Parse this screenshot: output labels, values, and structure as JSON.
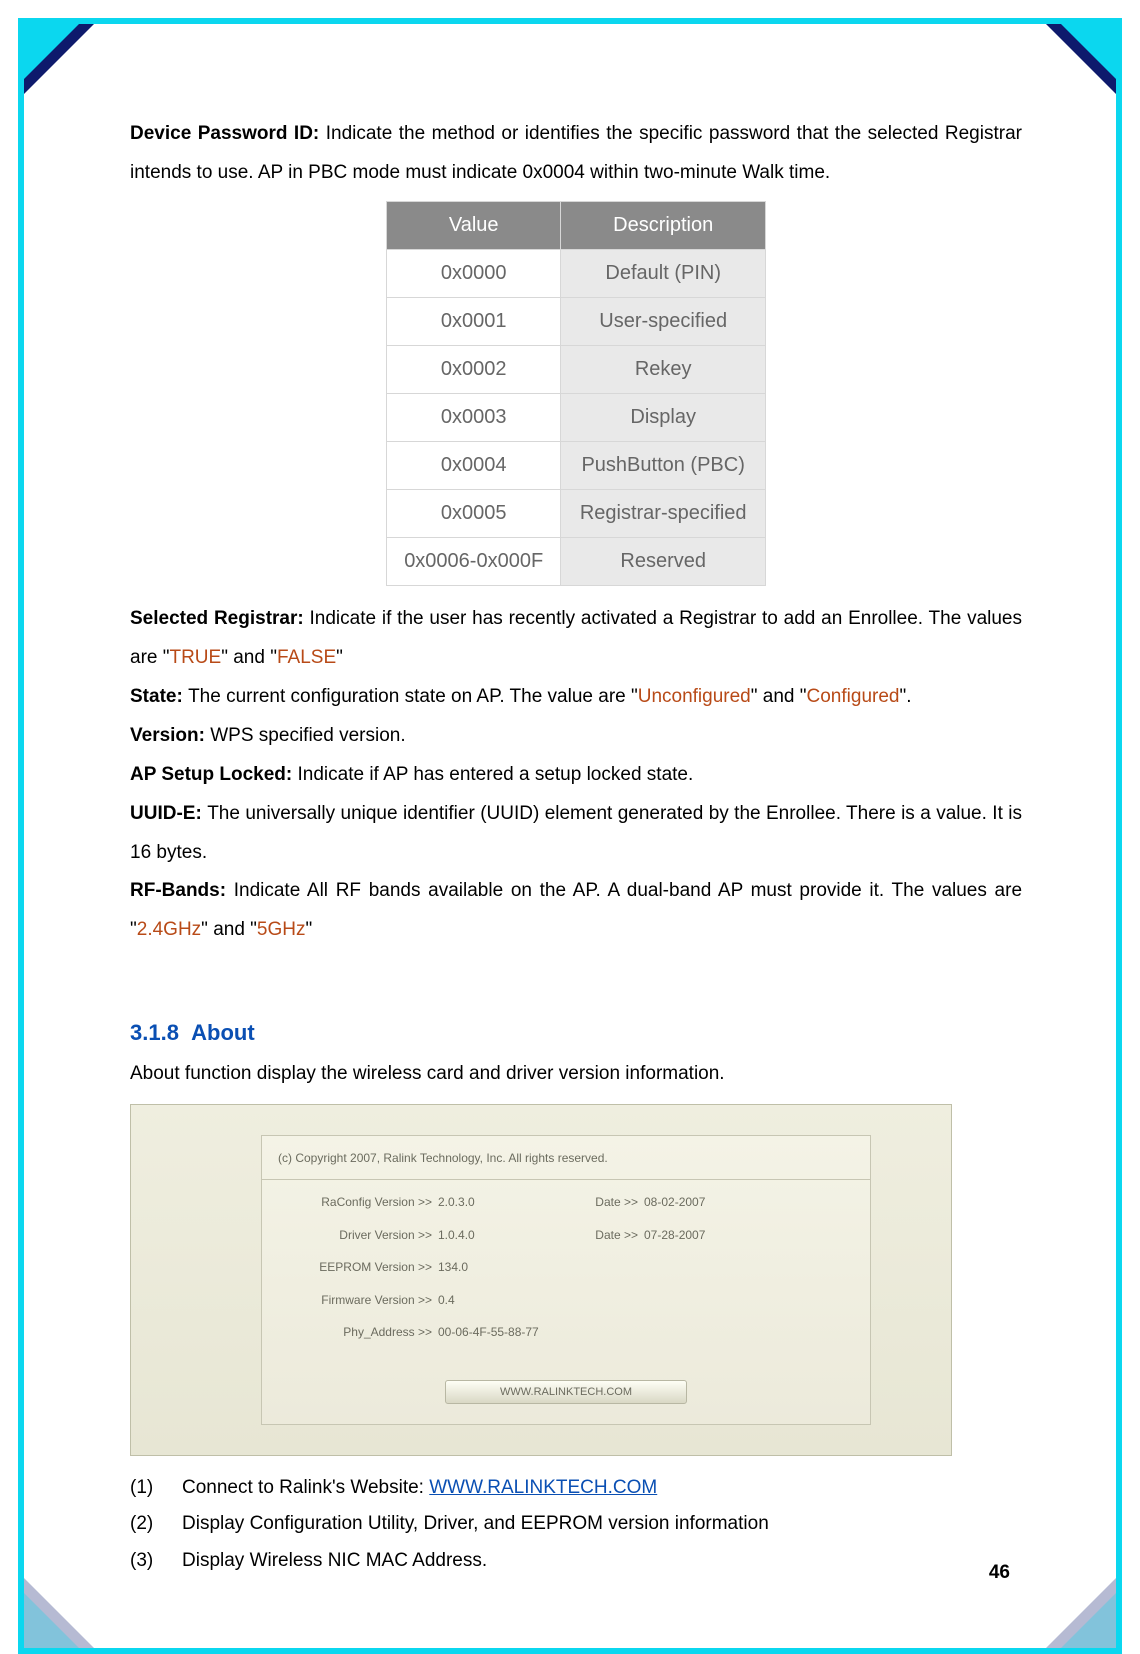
{
  "para": {
    "device_password_heading": "Device Password ID: ",
    "device_password_body": "Indicate the method or identifies the specific password that the selected Registrar intends to use. AP in PBC mode must indicate 0x0004 within two-minute Walk time.",
    "selected_registrar_heading": "Selected Registrar: ",
    "selected_registrar_body_1": "Indicate if the user has recently activated a Registrar to add an Enrollee. The values are \"",
    "true_v": "TRUE",
    "and_txt": "\" and \"",
    "false_v": "FALSE",
    "selected_registrar_body_2": "\"",
    "state_heading": "State: ",
    "state_body_1": "The current configuration state on AP. The value are \"",
    "unconfigured": "Unconfigured",
    "configured": "Configured",
    "state_body_2": "\".",
    "version_heading": "Version: ",
    "version_body": "WPS specified version.",
    "ap_setup_heading": "AP Setup Locked: ",
    "ap_setup_body": "Indicate if AP has entered a setup locked state.",
    "uuide_heading": "UUID-E: ",
    "uuide_body": "The universally unique identifier (UUID) element generated by the Enrollee. There is a value. It is 16 bytes.",
    "rf_heading": "RF-Bands: ",
    "rf_body_1": "Indicate All RF bands available on the AP. A dual-band AP must provide it. The values are \"",
    "b24": "2.4GHz",
    "b5": "5GHz",
    "rf_body_2": "\""
  },
  "value_table": {
    "h1": "Value",
    "h2": "Description",
    "rows": [
      {
        "v": "0x0000",
        "d": "Default (PIN)"
      },
      {
        "v": "0x0001",
        "d": "User-specified"
      },
      {
        "v": "0x0002",
        "d": "Rekey"
      },
      {
        "v": "0x0003",
        "d": "Display"
      },
      {
        "v": "0x0004",
        "d": "PushButton (PBC)"
      },
      {
        "v": "0x0005",
        "d": "Registrar-specified"
      },
      {
        "v": "0x0006-0x000F",
        "d": "Reserved"
      }
    ]
  },
  "about": {
    "section_number": "3.1.8",
    "section_title": "About",
    "intro": "About function display the wireless card and driver version information.",
    "copyright": "(c) Copyright 2007, Ralink Technology, Inc. All rights reserved.",
    "rows": [
      {
        "lbl": "RaConfig Version >>",
        "val": "2.0.3.0",
        "dlbl": "Date >>",
        "dval": "08-02-2007"
      },
      {
        "lbl": "Driver Version >>",
        "val": "1.0.4.0",
        "dlbl": "Date >>",
        "dval": "07-28-2007"
      },
      {
        "lbl": "EEPROM Version >>",
        "val": "134.0",
        "dlbl": "",
        "dval": ""
      },
      {
        "lbl": "Firmware Version >>",
        "val": "0.4",
        "dlbl": "",
        "dval": ""
      },
      {
        "lbl": "Phy_Address >>",
        "val": "00-06-4F-55-88-77",
        "dlbl": "",
        "dval": ""
      }
    ],
    "button": "WWW.RALINKTECH.COM"
  },
  "list": {
    "items": [
      {
        "num": "(1)",
        "txt_pre": "Connect to Ralink's Website: ",
        "link": "WWW.RALINKTECH.COM",
        "txt_post": ""
      },
      {
        "num": "(2)",
        "txt_pre": "Display Configuration Utility, Driver, and EEPROM version information",
        "link": "",
        "txt_post": ""
      },
      {
        "num": "(3)",
        "txt_pre": "Display Wireless NIC MAC Address.",
        "link": "",
        "txt_post": ""
      }
    ]
  },
  "page_number": "46"
}
